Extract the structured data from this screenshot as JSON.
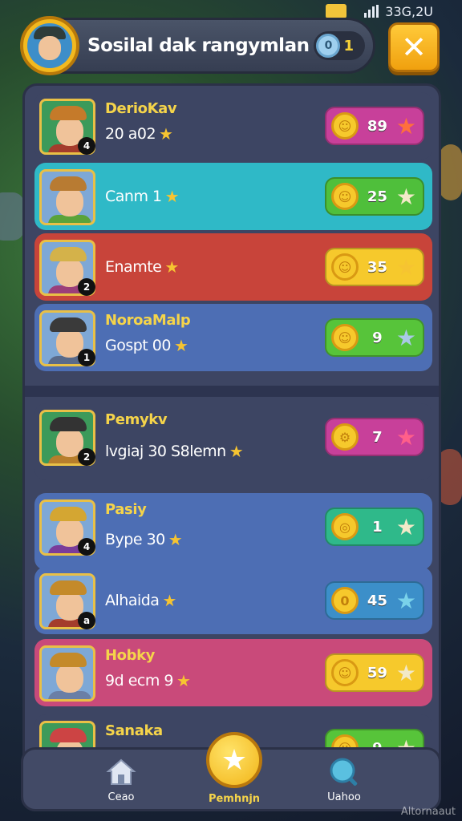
{
  "status": {
    "time": "33G,2U"
  },
  "header": {
    "title": "Sosilal dak rangymlan",
    "count": "1",
    "coin_symbol": "0"
  },
  "close_symbol": "✕",
  "rows": [
    {
      "name": "DerioKav",
      "sub": "20 a02",
      "value": "89",
      "coin_symbol": "☺",
      "rank": "4",
      "bg": "#3d4563",
      "pill": "#c8409a",
      "star_color": "#ff6f3c",
      "hat": "#c57a2a",
      "body": "#a43c2c"
    },
    {
      "name": "",
      "sub": "Canm 1",
      "value": "25",
      "coin_symbol": "☺",
      "rank": "",
      "bg": "#2fb9c7",
      "pill": "#4fbf3b",
      "star_color": "#f2e9c8",
      "hat": "#b87b32",
      "body": "#5aa33a"
    },
    {
      "name": "",
      "sub": "Enamte",
      "value": "35",
      "coin_symbol": "☺",
      "rank": "2",
      "bg": "#c8443a",
      "pill": "#f6c92c",
      "star_color": "#f6c431",
      "hat": "#d4b24a",
      "body": "#9b3e7a"
    },
    {
      "name": "NoroaMalp",
      "sub": "Gospt 00",
      "value": "9",
      "coin_symbol": "☺",
      "rank": "1",
      "bg": "#4d6eb4",
      "pill": "#57c43a",
      "star_color": "#a9c9e6",
      "hat": "#3a3a3a",
      "body": "#596a8a"
    },
    {
      "name": "Pemykv",
      "sub": "lvgiaj 30 S8lemn",
      "value": "7",
      "coin_symbol": "⚙",
      "rank": "2",
      "bg": "#3d4563",
      "pill": "#c8409a",
      "star_color": "#ff5f8a",
      "hat": "#333333",
      "body": "#b77e2c"
    },
    {
      "name": "Pasiy",
      "sub": "Bype 30",
      "value": "1",
      "coin_symbol": "◎",
      "rank": "4",
      "bg": "#4d6eb4",
      "pill": "#2fb98a",
      "star_color": "#f2e9c8",
      "hat": "#d4a632",
      "body": "#7a3c9a"
    },
    {
      "name": "",
      "sub": "Alhaida",
      "value": "45",
      "coin_symbol": "0",
      "rank": "a",
      "bg": "#4d6eb4",
      "pill": "#3c8fc9",
      "star_color": "#7ad2ea",
      "hat": "#c48a2a",
      "body": "#a43c2c"
    },
    {
      "name": "Hobky",
      "sub": "9d ecm 9",
      "value": "59",
      "coin_symbol": "☺",
      "rank": "",
      "bg": "#c94a7a",
      "pill": "#f6c92c",
      "star_color": "#f2e9c8",
      "hat": "#c48a2a",
      "body": "#6a7fa6"
    },
    {
      "name": "Sanaka",
      "sub": "",
      "value": "9",
      "coin_symbol": "☺",
      "rank": "",
      "bg": "#3d4563",
      "pill": "#57c43a",
      "star_color": "#f2e9c8",
      "hat": "#c44",
      "body": "#ddd"
    }
  ],
  "nav": {
    "home_label": "Ceao",
    "center_label": "Pemhnjn",
    "right_label": "Uahoo"
  },
  "watermark": "Altornaaut"
}
